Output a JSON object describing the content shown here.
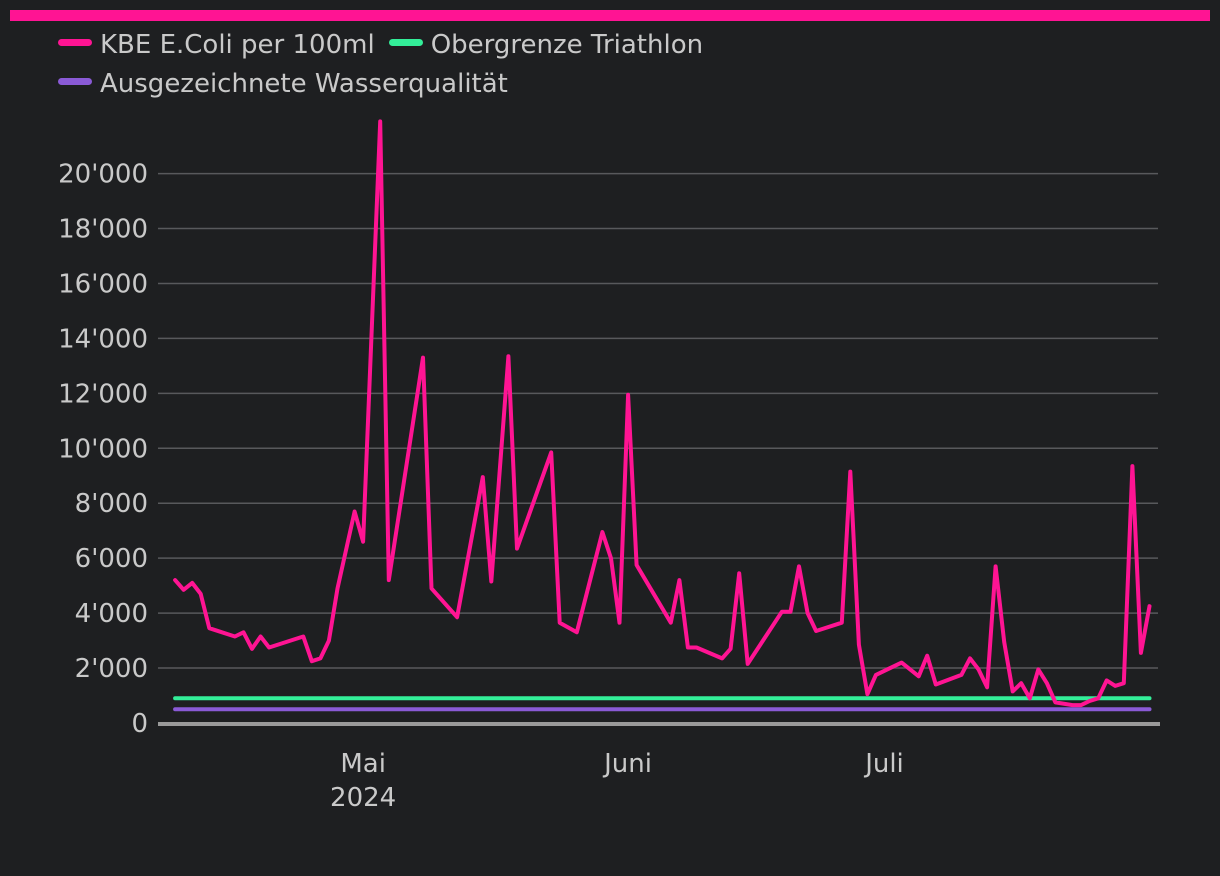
{
  "colors": {
    "background": "#1e1f21",
    "accent": "#ff1493",
    "grid": "#58595c",
    "axis": "#9a9a9a",
    "text": "#c9c9c9"
  },
  "chart_data": {
    "type": "line",
    "title": "",
    "xlabel": "",
    "ylabel": "",
    "ylim": [
      0,
      22000
    ],
    "y_ticks": [
      {
        "value": 0,
        "label": "0"
      },
      {
        "value": 2000,
        "label": "2'000"
      },
      {
        "value": 4000,
        "label": "4'000"
      },
      {
        "value": 6000,
        "label": "6'000"
      },
      {
        "value": 8000,
        "label": "8'000"
      },
      {
        "value": 10000,
        "label": "10'000"
      },
      {
        "value": 12000,
        "label": "12'000"
      },
      {
        "value": 14000,
        "label": "14'000"
      },
      {
        "value": 16000,
        "label": "16'000"
      },
      {
        "value": 18000,
        "label": "18'000"
      },
      {
        "value": 20000,
        "label": "20'000"
      }
    ],
    "x_range": [
      "2024-04-07",
      "2024-08-02"
    ],
    "x_ticks": [
      {
        "date": "2024-05-01",
        "label": "Mai",
        "sublabel": "2024"
      },
      {
        "date": "2024-06-01",
        "label": "Juni",
        "sublabel": ""
      },
      {
        "date": "2024-07-01",
        "label": "Juli",
        "sublabel": ""
      }
    ],
    "legend_position": "top-left",
    "grid": true,
    "series": [
      {
        "name": "KBE E.Coli per 100ml",
        "color": "#ff1493",
        "points": [
          [
            "2024-04-09",
            5200
          ],
          [
            "2024-04-10",
            4850
          ],
          [
            "2024-04-11",
            5100
          ],
          [
            "2024-04-12",
            4700
          ],
          [
            "2024-04-13",
            3450
          ],
          [
            "2024-04-16",
            3150
          ],
          [
            "2024-04-17",
            3300
          ],
          [
            "2024-04-18",
            2700
          ],
          [
            "2024-04-19",
            3150
          ],
          [
            "2024-04-20",
            2750
          ],
          [
            "2024-04-24",
            3150
          ],
          [
            "2024-04-25",
            2250
          ],
          [
            "2024-04-26",
            2350
          ],
          [
            "2024-04-27",
            3000
          ],
          [
            "2024-04-28",
            4900
          ],
          [
            "2024-04-30",
            7700
          ],
          [
            "2024-05-01",
            6600
          ],
          [
            "2024-05-03",
            21900
          ],
          [
            "2024-05-04",
            5200
          ],
          [
            "2024-05-08",
            13300
          ],
          [
            "2024-05-09",
            4900
          ],
          [
            "2024-05-12",
            3850
          ],
          [
            "2024-05-15",
            8950
          ],
          [
            "2024-05-16",
            5150
          ],
          [
            "2024-05-18",
            13350
          ],
          [
            "2024-05-19",
            6350
          ],
          [
            "2024-05-23",
            9850
          ],
          [
            "2024-05-24",
            3650
          ],
          [
            "2024-05-26",
            3300
          ],
          [
            "2024-05-29",
            6950
          ],
          [
            "2024-05-30",
            6000
          ],
          [
            "2024-05-31",
            3650
          ],
          [
            "2024-06-01",
            11950
          ],
          [
            "2024-06-02",
            5750
          ],
          [
            "2024-06-06",
            3650
          ],
          [
            "2024-06-07",
            5200
          ],
          [
            "2024-06-08",
            2750
          ],
          [
            "2024-06-09",
            2750
          ],
          [
            "2024-06-12",
            2350
          ],
          [
            "2024-06-13",
            2700
          ],
          [
            "2024-06-14",
            5450
          ],
          [
            "2024-06-15",
            2150
          ],
          [
            "2024-06-19",
            4050
          ],
          [
            "2024-06-20",
            4050
          ],
          [
            "2024-06-21",
            5700
          ],
          [
            "2024-06-22",
            4000
          ],
          [
            "2024-06-23",
            3350
          ],
          [
            "2024-06-26",
            3650
          ],
          [
            "2024-06-27",
            9150
          ],
          [
            "2024-06-28",
            2850
          ],
          [
            "2024-06-29",
            1050
          ],
          [
            "2024-06-30",
            1750
          ],
          [
            "2024-07-03",
            2200
          ],
          [
            "2024-07-05",
            1700
          ],
          [
            "2024-07-06",
            2450
          ],
          [
            "2024-07-07",
            1400
          ],
          [
            "2024-07-10",
            1750
          ],
          [
            "2024-07-11",
            2350
          ],
          [
            "2024-07-12",
            1950
          ],
          [
            "2024-07-13",
            1300
          ],
          [
            "2024-07-14",
            5700
          ],
          [
            "2024-07-15",
            2950
          ],
          [
            "2024-07-16",
            1150
          ],
          [
            "2024-07-17",
            1450
          ],
          [
            "2024-07-18",
            900
          ],
          [
            "2024-07-19",
            1950
          ],
          [
            "2024-07-20",
            1450
          ],
          [
            "2024-07-21",
            750
          ],
          [
            "2024-07-23",
            650
          ],
          [
            "2024-07-24",
            650
          ],
          [
            "2024-07-25",
            800
          ],
          [
            "2024-07-26",
            900
          ],
          [
            "2024-07-27",
            1550
          ],
          [
            "2024-07-28",
            1350
          ],
          [
            "2024-07-29",
            1450
          ],
          [
            "2024-07-30",
            9350
          ],
          [
            "2024-07-31",
            2550
          ],
          [
            "2024-08-01",
            4250
          ]
        ]
      },
      {
        "name": "Obergrenze Triathlon",
        "color": "#33ee99",
        "points": [
          [
            "2024-04-09",
            900
          ],
          [
            "2024-08-01",
            900
          ]
        ]
      },
      {
        "name": "Ausgezeichnete Wasserqualität",
        "color": "#8a5ad6",
        "points": [
          [
            "2024-04-09",
            500
          ],
          [
            "2024-08-01",
            500
          ]
        ]
      }
    ]
  }
}
